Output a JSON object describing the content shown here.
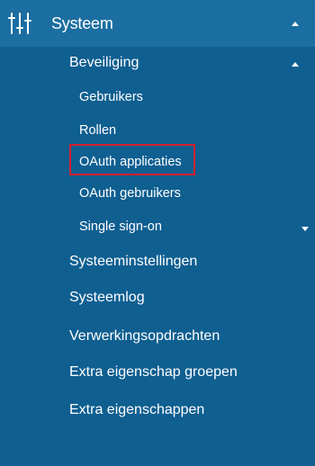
{
  "menu": {
    "header": {
      "label": "Systeem",
      "icon": "sliders-icon"
    },
    "security": {
      "label": "Beveiliging",
      "items": [
        {
          "label": "Gebruikers"
        },
        {
          "label": "Rollen"
        },
        {
          "label": "OAuth applicaties",
          "highlighted": true
        },
        {
          "label": "OAuth gebruikers"
        },
        {
          "label": "Single sign-on"
        }
      ]
    },
    "items": [
      {
        "label": "Systeeminstellingen"
      },
      {
        "label": "Systeemlog"
      },
      {
        "label": "Verwerkingsopdrachten"
      },
      {
        "label": "Extra eigenschap groepen"
      },
      {
        "label": "Extra eigenschappen"
      }
    ]
  },
  "colors": {
    "background": "#0f5f91",
    "header_background": "#1b6ea1",
    "highlight": "#d0222e",
    "text": "#ffffff"
  }
}
